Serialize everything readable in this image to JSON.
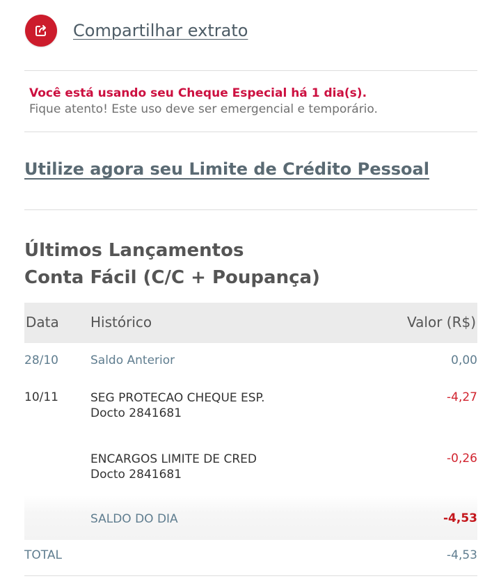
{
  "share": {
    "label": "Compartilhar extrato",
    "icon": "share-icon",
    "icon_color": "#cc1c2c"
  },
  "alert": {
    "title": "Você está usando seu Cheque Especial há 1 dia(s).",
    "body": "Fique atento! Este uso deve ser emergencial e temporário."
  },
  "credit_link": "Utilize agora seu Limite de Crédito Pessoal",
  "section": {
    "title_line1": "Últimos Lançamentos",
    "title_line2": "Conta Fácil (C/C + Poupança)"
  },
  "table": {
    "headers": {
      "date": "Data",
      "history": "Histórico",
      "value": "Valor (R$)"
    },
    "rows": [
      {
        "date": "28/10",
        "history": "Saldo Anterior",
        "doc": "",
        "value": "0,00"
      },
      {
        "date": "10/11",
        "history": "SEG PROTECAO CHEQUE ESP.",
        "doc": "Docto 2841681",
        "value": "-4,27"
      },
      {
        "date": "",
        "history": "ENCARGOS LIMITE DE CRED",
        "doc": "Docto 2841681",
        "value": "-0,26"
      }
    ],
    "day_balance": {
      "label": "SALDO DO DIA",
      "value": "-4,53"
    },
    "total": {
      "label": "TOTAL",
      "value": "-4,53"
    }
  },
  "colors": {
    "accent_red": "#cc1c2c",
    "alert_red": "#cc1040",
    "negative_red": "#d1242f",
    "link_gray": "#5a6a73",
    "muted_blue": "#5f7d8f"
  }
}
